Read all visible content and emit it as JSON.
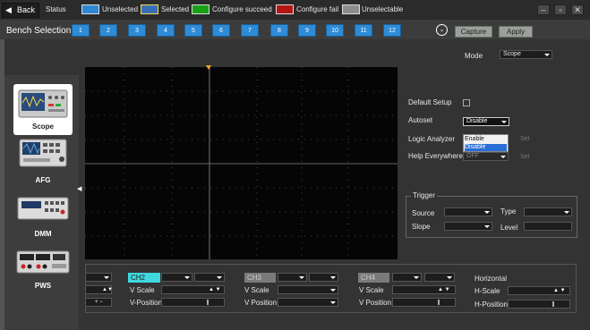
{
  "titlebar": {
    "back_label": "Back",
    "status_label": "Status",
    "legend": [
      {
        "label": "Unselected",
        "color": "#2f86d3"
      },
      {
        "label": "Selected",
        "color": "#3b6fb5"
      },
      {
        "label": "Configure succeed",
        "color": "#17a317"
      },
      {
        "label": "Configure fail",
        "color": "#b51515"
      },
      {
        "label": "Unselectable",
        "color": "#8c8c8c"
      }
    ]
  },
  "bench": {
    "label": "Bench Selection",
    "numbers": [
      "1",
      "2",
      "3",
      "4",
      "5",
      "6",
      "7",
      "8",
      "9",
      "10",
      "11",
      "12"
    ],
    "capture_label": "Capture",
    "apply_label": "Apply"
  },
  "instruments": [
    {
      "label": "Scope",
      "icon": "oscilloscope-icon",
      "selected": true
    },
    {
      "label": "AFG",
      "icon": "function-generator-icon",
      "selected": false
    },
    {
      "label": "DMM",
      "icon": "multimeter-icon",
      "selected": false
    },
    {
      "label": "PWS",
      "icon": "power-supply-icon",
      "selected": false
    }
  ],
  "settings": {
    "mode_label": "Mode",
    "mode_value": "Scope",
    "default_setup_label": "Default Setup",
    "autoset_label": "Autoset",
    "autoset_value": "Disable",
    "autoset_options": [
      "Enable",
      "Disable"
    ],
    "logic_analyzer_label": "Logic Analyzer",
    "help_everywhere_label": "Help Everywhere",
    "help_everywhere_value": "OFF",
    "set_label": "Set"
  },
  "trigger": {
    "title": "Trigger",
    "source_label": "Source",
    "type_label": "Type",
    "slope_label": "Slope",
    "level_label": "Level"
  },
  "channels": [
    {
      "name": "CH2",
      "active": true
    },
    {
      "name": "CH3",
      "active": false
    },
    {
      "name": "CH4",
      "active": false
    }
  ],
  "channel_fields": {
    "v_scale": "V Scale",
    "v_position": "V Position",
    "v_position_ch2": "V-Position"
  },
  "horizontal": {
    "title": "Horizontal",
    "h_scale": "H-Scale",
    "h_position": "H-Position"
  }
}
